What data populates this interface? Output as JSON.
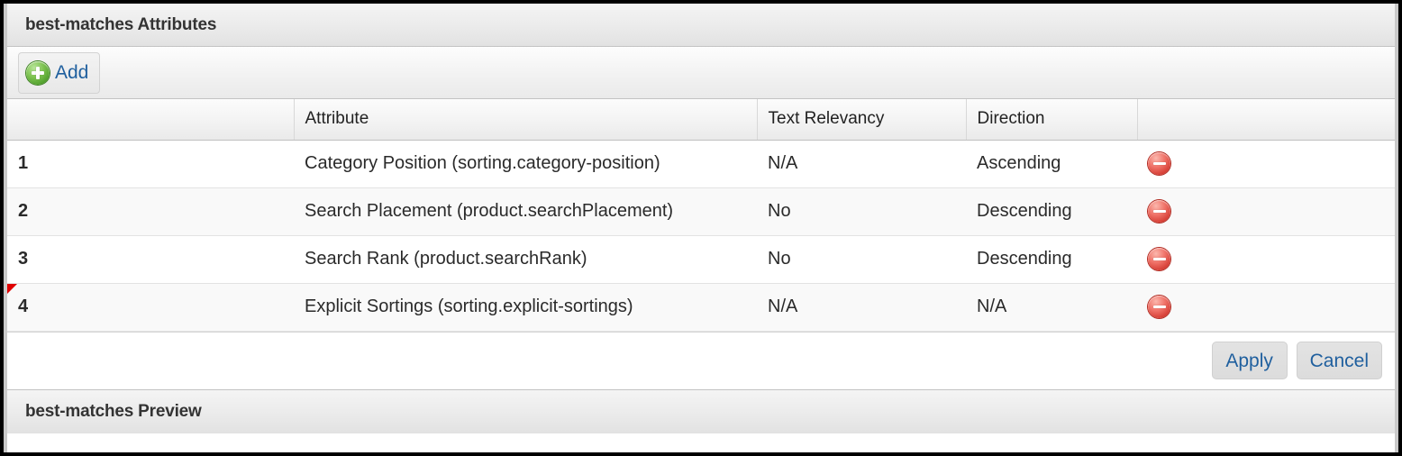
{
  "panels": {
    "attributes_title": "best-matches Attributes",
    "preview_title": "best-matches Preview"
  },
  "toolbar": {
    "add_label": "Add",
    "add_icon": "add-circle-icon"
  },
  "grid": {
    "columns": [
      {
        "key": "index",
        "label": ""
      },
      {
        "key": "attribute",
        "label": "Attribute"
      },
      {
        "key": "text_relevancy",
        "label": "Text Relevancy"
      },
      {
        "key": "direction",
        "label": "Direction"
      },
      {
        "key": "action",
        "label": ""
      }
    ],
    "rows": [
      {
        "index": "1",
        "attribute": "Category Position (sorting.category-position)",
        "text_relevancy": "N/A",
        "direction": "Ascending",
        "dirty": false,
        "action_icon": "delete-circle-icon"
      },
      {
        "index": "2",
        "attribute": "Search Placement (product.searchPlacement)",
        "text_relevancy": "No",
        "direction": "Descending",
        "dirty": false,
        "action_icon": "delete-circle-icon"
      },
      {
        "index": "3",
        "attribute": "Search Rank (product.searchRank)",
        "text_relevancy": "No",
        "direction": "Descending",
        "dirty": false,
        "action_icon": "delete-circle-icon"
      },
      {
        "index": "4",
        "attribute": "Explicit Sortings (sorting.explicit-sortings)",
        "text_relevancy": "N/A",
        "direction": "N/A",
        "dirty": true,
        "action_icon": "delete-circle-icon"
      }
    ]
  },
  "footer": {
    "apply_label": "Apply",
    "cancel_label": "Cancel"
  },
  "colors": {
    "link_blue": "#1f5f9e",
    "add_green": "#4f9e2c",
    "delete_red": "#d63f36",
    "dirty_marker_red": "#e00000",
    "title_text": "#333333"
  }
}
